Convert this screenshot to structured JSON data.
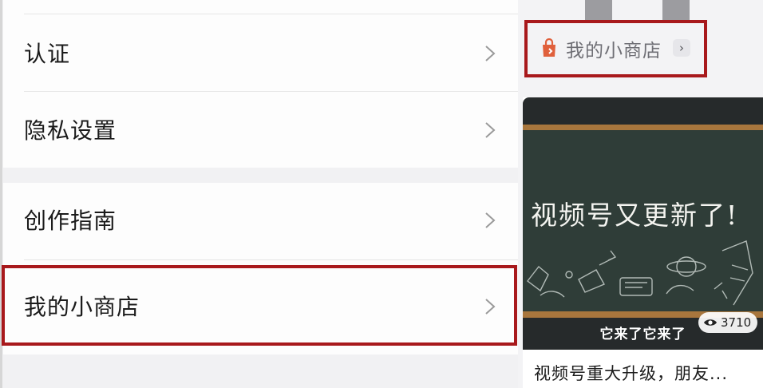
{
  "settings": {
    "items": [
      {
        "label": "认证"
      },
      {
        "label": "隐私设置"
      },
      {
        "label": "创作指南"
      },
      {
        "label": "我的小商店"
      }
    ]
  },
  "shop_link": {
    "label": "我的小商店",
    "chevron": "›",
    "icon": "shopping-bag-icon"
  },
  "video": {
    "board_title": "视频号又更新了!",
    "subtitle": "它来了它来了",
    "views": "3710",
    "title": "视频号重大升级，朋友..."
  },
  "colors": {
    "highlight": "#a8191c",
    "bag_icon": "#e0603c",
    "board": "#2f3d38",
    "frame": "#a8763d"
  }
}
